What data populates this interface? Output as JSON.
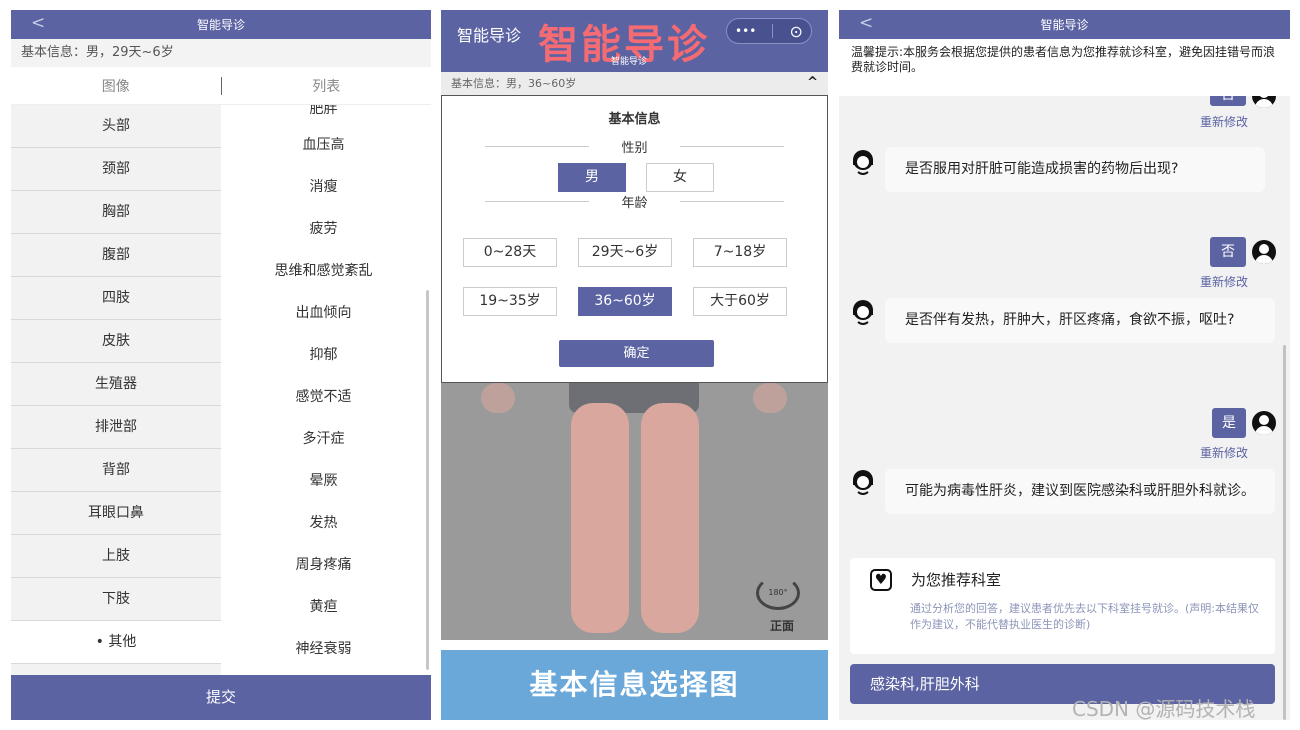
{
  "panel1": {
    "header_title": "智能导诊",
    "back_glyph": "<",
    "basic_info": "基本信息：男，29天~6岁",
    "tabs": [
      "图像",
      "列表"
    ],
    "left_items": [
      "头部",
      "颈部",
      "胸部",
      "腹部",
      "四肢",
      "皮肤",
      "生殖器",
      "排泄部",
      "背部",
      "耳眼口鼻",
      "上肢",
      "下肢",
      "• 其他"
    ],
    "right_items_partial": "肥胖",
    "right_items": [
      "血压高",
      "消瘦",
      "疲劳",
      "思维和感觉紊乱",
      "出血倾向",
      "抑郁",
      "感觉不适",
      "多汗症",
      "晕厥",
      "发热",
      "周身疼痛",
      "黄疸",
      "神经衰弱"
    ],
    "submit_label": "提交"
  },
  "panel2": {
    "app_title": "智能导诊",
    "big_title": "智能导诊",
    "sub_title": "智能导诊",
    "capsule_menu": "•••",
    "capsule_close": "⊙",
    "basic_info": "基本信息：男，36~60岁",
    "caret": "^",
    "modal_title": "基本信息",
    "gender_label": "性别",
    "genders": [
      "男",
      "女"
    ],
    "age_label": "年龄",
    "ages": [
      "0~28天",
      "29天~6岁",
      "7~18岁",
      "19~35岁",
      "36~60岁",
      "大于60岁"
    ],
    "confirm_label": "确定",
    "rotate_degrees": "180°",
    "rotate_label": "正面",
    "banner": "基本信息选择图"
  },
  "panel3": {
    "header_title": "智能导诊",
    "back_glyph": "<",
    "notice": "温馨提示:本服务会根据您提供的患者信息为您推荐就诊科室，避免因挂错号而浪费就诊时间。",
    "chat": {
      "answer0": "否",
      "redo0": "重新修改",
      "question1": "是否服用对肝脏可能造成损害的药物后出现?",
      "answer1": "否",
      "redo1": "重新修改",
      "question2": "是否伴有发热，肝肿大，肝区疼痛，食欲不振，呕吐?",
      "answer2": "是",
      "redo2": "重新修改",
      "question3": "可能为病毒性肝炎，建议到医院感染科或肝胆外科就诊。"
    },
    "rec_title": "为您推荐科室",
    "rec_desc": "通过分析您的回答，建议患者优先去以下科室挂号就诊。(声明:本结果仅作为建议，不能代替执业医生的诊断)",
    "dept": "感染科,肝胆外科"
  },
  "watermark": "CSDN @源码技术栈",
  "colors": {
    "brand": "#5b63a3",
    "accent_red": "#f56b73",
    "banner": "#6aa8da",
    "link": "#5b63a3"
  }
}
